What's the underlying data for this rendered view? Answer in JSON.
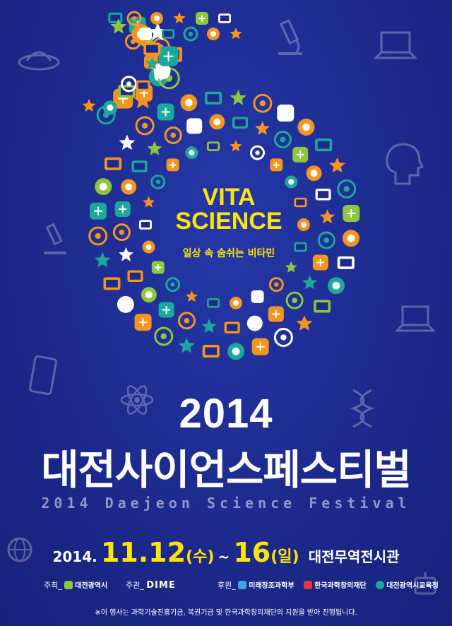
{
  "center": {
    "line1": "VITA",
    "line2": "SCIENCE",
    "subtitle": "일상 속 숨쉬는 비타민"
  },
  "event": {
    "year": "2014",
    "title_ko": "대전사이언스페스티벌",
    "title_en": "2014 Daejeon Science Festival"
  },
  "date": {
    "prefix": "2014.",
    "month": "11.",
    "start_day": "12",
    "start_weekday": "(수)",
    "tilde": "~",
    "end_day": "16",
    "end_weekday": "(일)",
    "venue": "대전무역전시관"
  },
  "sponsors": {
    "host_label": "주최_",
    "host_org": "대전광역시",
    "organizer_label": "주관_",
    "organizer_org": "DIME",
    "supporter_label": "후원_",
    "supporters": [
      "미래창조과학부",
      "한국과학창의재단",
      "대전광역시교육청"
    ]
  },
  "note": "※이 행사는 과학기술진흥기금, 복권기금 및 한국과학창의재단의 지원을 받아 진행됩니다.",
  "colors": {
    "background": "#1d2a8c",
    "accent_yellow": "#ffe600",
    "orange": "#f7941d",
    "teal": "#1aa99a",
    "green": "#8dc63f"
  },
  "icons": [
    "atom-icon",
    "microscope-icon",
    "robot-icon",
    "tv-icon",
    "gear-icon",
    "lightbulb-icon",
    "music-note-icon",
    "headset-icon",
    "dna-icon",
    "rocket-icon",
    "laptop-icon",
    "phone-icon",
    "envelope-icon",
    "ufo-icon"
  ]
}
